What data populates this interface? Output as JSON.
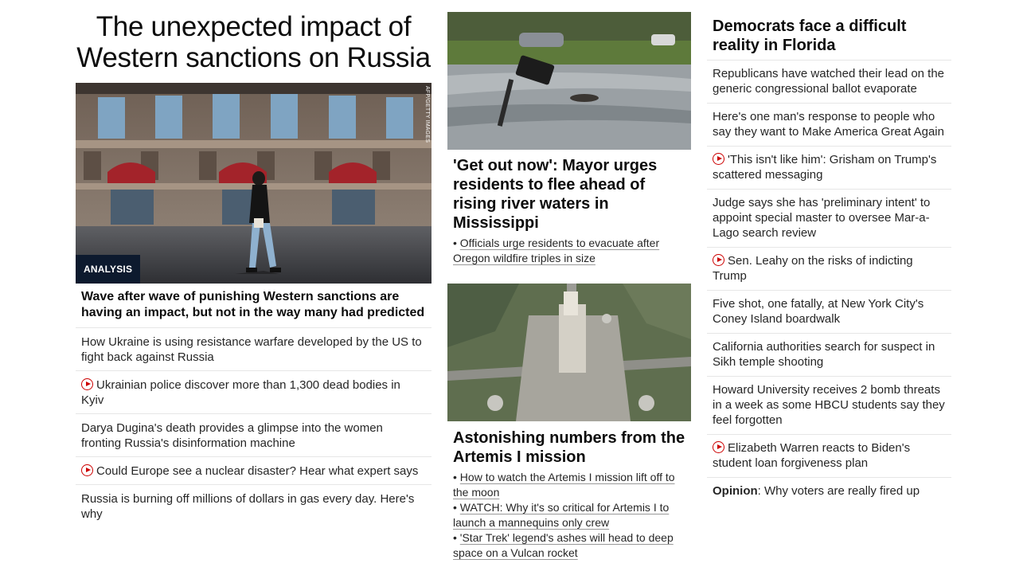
{
  "col1": {
    "title": "The unexpected impact of Western sanctions on Russia",
    "image_credit": "AFP/GETTY IMAGES",
    "badge": "ANALYSIS",
    "lead": "Wave after wave of punishing Western sanctions are having an impact, but not in the way many had predicted",
    "items": [
      {
        "text": "How Ukraine is using resistance warfare developed by the US to fight back against Russia",
        "video": false
      },
      {
        "text": "Ukrainian police discover more than 1,300 dead bodies in Kyiv",
        "video": true
      },
      {
        "text": "Darya Dugina's death provides a glimpse into the women fronting Russia's disinformation machine",
        "video": false
      },
      {
        "text": "Could Europe see a nuclear disaster? Hear what expert says",
        "video": true
      },
      {
        "text": "Russia is burning off millions of dollars in gas every day. Here's why",
        "video": false
      }
    ]
  },
  "col2": {
    "story1": {
      "headline": "'Get out now': Mayor urges residents to flee ahead of rising river waters in Mississippi",
      "links": [
        "Officials urge residents to evacuate after Oregon wildfire triples in size"
      ]
    },
    "story2": {
      "headline": "Astonishing numbers from the Artemis I mission",
      "links": [
        "How to watch the Artemis I mission lift off to the moon",
        "WATCH: Why it's so critical for Artemis I to launch a mannequins only crew",
        "'Star Trek' legend's ashes will head to deep space on a Vulcan rocket"
      ]
    }
  },
  "col3": {
    "headline": "Democrats face a difficult reality in Florida",
    "items": [
      {
        "text": "Republicans have watched their lead on the generic congressional ballot evaporate",
        "video": false
      },
      {
        "text": "Here's one man's response to people who say they want to Make America Great Again",
        "video": false
      },
      {
        "text": "'This isn't like him': Grisham on Trump's scattered messaging",
        "video": true
      },
      {
        "text": "Judge says she has 'preliminary intent' to appoint special master to oversee Mar-a-Lago search review",
        "video": false
      },
      {
        "text": "Sen. Leahy on the risks of indicting Trump",
        "video": true
      },
      {
        "text": "Five shot, one fatally, at New York City's Coney Island boardwalk",
        "video": false
      },
      {
        "text": "California authorities search for suspect in Sikh temple shooting",
        "video": false
      },
      {
        "text": "Howard University receives 2 bomb threats in a week as some HBCU students say they feel forgotten",
        "video": false
      },
      {
        "text": "Elizabeth Warren reacts to Biden's student loan forgiveness plan",
        "video": true
      }
    ],
    "opinion_label": "Opinion",
    "opinion_text": ": Why voters are really fired up"
  },
  "colors": {
    "play_red": "#cc0000",
    "badge_bg": "#0d1a2e",
    "divider": "#e6e6e6"
  }
}
